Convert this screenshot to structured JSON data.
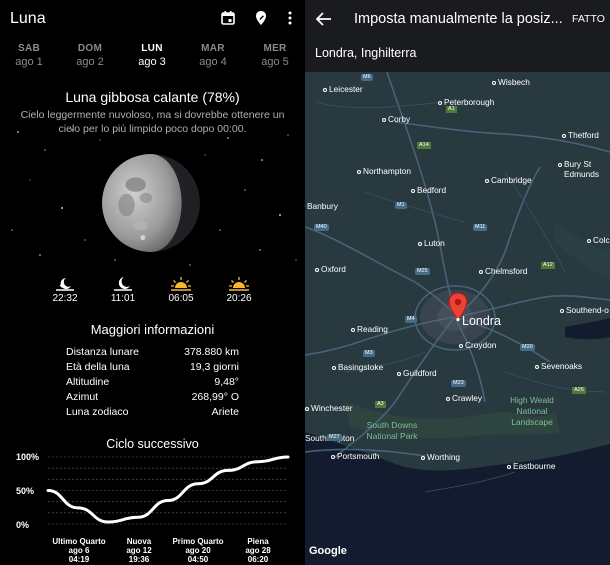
{
  "left": {
    "app_title": "Luna",
    "icons": {
      "calendar": "calendar-icon",
      "location": "location-pin-icon",
      "more": "more-vert-icon"
    },
    "days": [
      {
        "name": "SAB",
        "sub": "ago 1",
        "selected": false
      },
      {
        "name": "DOM",
        "sub": "ago 2",
        "selected": false
      },
      {
        "name": "LUN",
        "sub": "ago 3",
        "selected": true
      },
      {
        "name": "MAR",
        "sub": "ago 4",
        "selected": false
      },
      {
        "name": "MER",
        "sub": "ago 5",
        "selected": false
      }
    ],
    "phase_title": "Luna gibbosa calante (78%)",
    "forecast": "Cielo leggermente nuvoloso, ma si dovrebbe ottenere un cielo per lo più limpido poco dopo 00:00.",
    "rise_set": [
      {
        "icon": "moonset-icon",
        "time": "22:32"
      },
      {
        "icon": "moonrise-icon",
        "time": "11:01"
      },
      {
        "icon": "sunrise-icon",
        "time": "06:05"
      },
      {
        "icon": "sunset-icon",
        "time": "20:26"
      }
    ],
    "more_title": "Maggiori informazioni",
    "info": [
      {
        "key": "Distanza lunare",
        "value": "378.880 km"
      },
      {
        "key": "Età della luna",
        "value": "19,3 giorni"
      },
      {
        "key": "Altitudine",
        "value": "9,48°"
      },
      {
        "key": "Azimut",
        "value": "268,99° O"
      },
      {
        "key": "Luna zodiaco",
        "value": "Ariete"
      }
    ],
    "cycle_title": "Ciclo successivo",
    "chart_data": {
      "type": "line",
      "y_ticks": [
        "100%",
        "50%",
        "0%"
      ],
      "ylim": [
        0,
        100
      ],
      "x": [
        0,
        1,
        2,
        3,
        4,
        5,
        6,
        7,
        8
      ],
      "values": [
        50,
        24,
        3,
        10,
        35,
        60,
        80,
        93,
        100
      ],
      "grid": true,
      "labels": [
        {
          "name": "Ultimo Quarto",
          "date": "ago 6",
          "time": "04:19"
        },
        {
          "name": "Nuova",
          "date": "ago 12",
          "time": "19:36"
        },
        {
          "name": "Primo Quarto",
          "date": "ago 20",
          "time": "04:50"
        },
        {
          "name": "Piena",
          "date": "ago 28",
          "time": "06:20"
        }
      ]
    }
  },
  "right": {
    "title": "Imposta manualmente la posiz...",
    "done_label": "FATTO",
    "location": "Londra, Inghilterra",
    "main_city": "Londra",
    "cities": [
      "Leicester",
      "Wisbech",
      "Peterborough",
      "Corby",
      "Thetford",
      "Northampton",
      "Bury St Edmunds",
      "Cambridge",
      "Bedford",
      "Banbury",
      "Luton",
      "Colch",
      "Oxford",
      "Chelmsford",
      "Reading",
      "Southend-o",
      "Croydon",
      "Basingstoke",
      "Guildford",
      "Sevenoaks",
      "Crawley",
      "Winchester",
      "Southampton",
      "Portsmouth",
      "Worthing",
      "Eastbourne"
    ],
    "parks": [
      "South Downs National Park",
      "High Weald National Landscape"
    ],
    "road_labels": [
      "A14",
      "M1",
      "M40",
      "M11",
      "A12",
      "M25",
      "M4",
      "M3",
      "M20",
      "M23",
      "M27",
      "A3",
      "M6",
      "A1",
      "A26"
    ],
    "attribution": "Google"
  }
}
